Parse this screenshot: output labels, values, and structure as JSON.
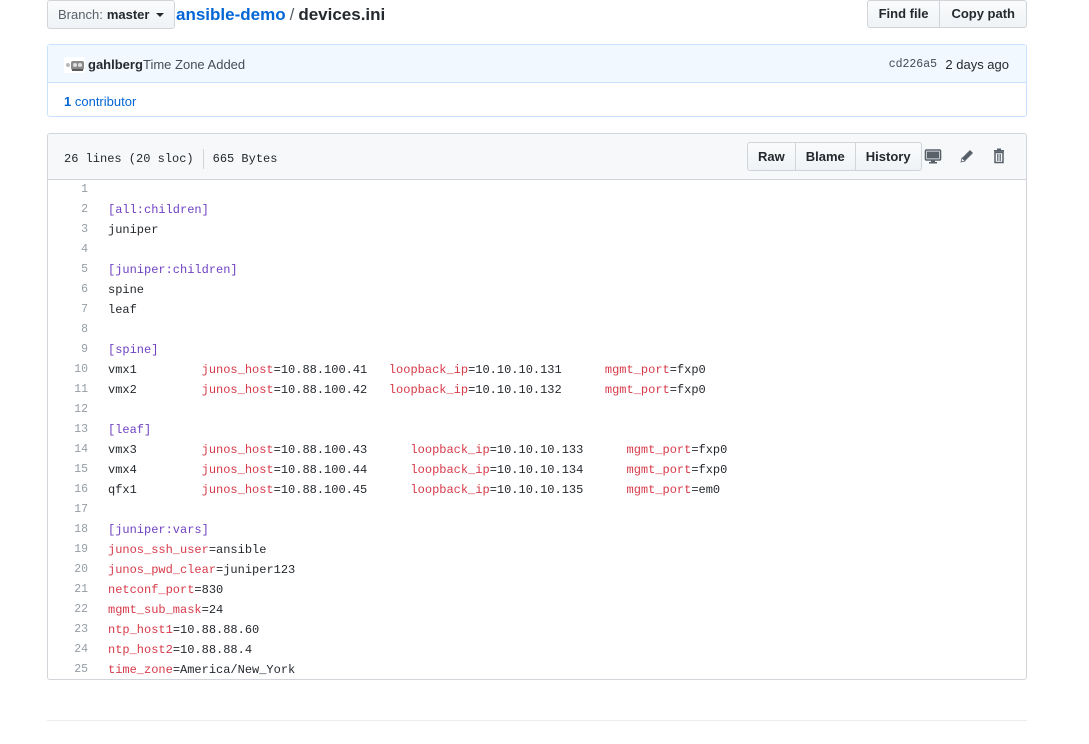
{
  "topbar": {
    "branch_label": "Branch:",
    "branch_value": "master",
    "repo": "ansible-demo",
    "separator": "/",
    "file": "devices.ini",
    "find_file": "Find file",
    "copy_path": "Copy path"
  },
  "commit": {
    "author": "gahlberg",
    "message": "Time Zone Added",
    "sha": "cd226a5",
    "when": "2 days ago",
    "contributor_count": "1",
    "contributor_label": "contributor"
  },
  "file_header": {
    "lines": "26 lines (20 sloc)",
    "size": "665 Bytes",
    "raw": "Raw",
    "blame": "Blame",
    "history": "History"
  },
  "code_lines": [
    {
      "n": "1",
      "parts": []
    },
    {
      "n": "2",
      "parts": [
        {
          "t": "[all:children]",
          "c": "sec"
        }
      ]
    },
    {
      "n": "3",
      "parts": [
        {
          "t": "juniper",
          "c": "val"
        }
      ]
    },
    {
      "n": "4",
      "parts": []
    },
    {
      "n": "5",
      "parts": [
        {
          "t": "[juniper:children]",
          "c": "sec"
        }
      ]
    },
    {
      "n": "6",
      "parts": [
        {
          "t": "spine",
          "c": "val"
        }
      ]
    },
    {
      "n": "7",
      "parts": [
        {
          "t": "leaf",
          "c": "val"
        }
      ]
    },
    {
      "n": "8",
      "parts": []
    },
    {
      "n": "9",
      "parts": [
        {
          "t": "[spine]",
          "c": "sec"
        }
      ]
    },
    {
      "n": "10",
      "parts": [
        {
          "t": "vmx1         ",
          "c": "val"
        },
        {
          "t": "junos_host",
          "c": "key"
        },
        {
          "t": "=10.88.100.41   ",
          "c": "val"
        },
        {
          "t": "loopback_ip",
          "c": "key"
        },
        {
          "t": "=10.10.10.131      ",
          "c": "val"
        },
        {
          "t": "mgmt_port",
          "c": "key"
        },
        {
          "t": "=fxp0",
          "c": "val"
        }
      ]
    },
    {
      "n": "11",
      "parts": [
        {
          "t": "vmx2         ",
          "c": "val"
        },
        {
          "t": "junos_host",
          "c": "key"
        },
        {
          "t": "=10.88.100.42   ",
          "c": "val"
        },
        {
          "t": "loopback_ip",
          "c": "key"
        },
        {
          "t": "=10.10.10.132      ",
          "c": "val"
        },
        {
          "t": "mgmt_port",
          "c": "key"
        },
        {
          "t": "=fxp0",
          "c": "val"
        }
      ]
    },
    {
      "n": "12",
      "parts": []
    },
    {
      "n": "13",
      "parts": [
        {
          "t": "[leaf]",
          "c": "sec"
        }
      ]
    },
    {
      "n": "14",
      "parts": [
        {
          "t": "vmx3         ",
          "c": "val"
        },
        {
          "t": "junos_host",
          "c": "key"
        },
        {
          "t": "=10.88.100.43      ",
          "c": "val"
        },
        {
          "t": "loopback_ip",
          "c": "key"
        },
        {
          "t": "=10.10.10.133      ",
          "c": "val"
        },
        {
          "t": "mgmt_port",
          "c": "key"
        },
        {
          "t": "=fxp0",
          "c": "val"
        }
      ]
    },
    {
      "n": "15",
      "parts": [
        {
          "t": "vmx4         ",
          "c": "val"
        },
        {
          "t": "junos_host",
          "c": "key"
        },
        {
          "t": "=10.88.100.44      ",
          "c": "val"
        },
        {
          "t": "loopback_ip",
          "c": "key"
        },
        {
          "t": "=10.10.10.134      ",
          "c": "val"
        },
        {
          "t": "mgmt_port",
          "c": "key"
        },
        {
          "t": "=fxp0",
          "c": "val"
        }
      ]
    },
    {
      "n": "16",
      "parts": [
        {
          "t": "qfx1         ",
          "c": "val"
        },
        {
          "t": "junos_host",
          "c": "key"
        },
        {
          "t": "=10.88.100.45      ",
          "c": "val"
        },
        {
          "t": "loopback_ip",
          "c": "key"
        },
        {
          "t": "=10.10.10.135      ",
          "c": "val"
        },
        {
          "t": "mgmt_port",
          "c": "key"
        },
        {
          "t": "=em0",
          "c": "val"
        }
      ]
    },
    {
      "n": "17",
      "parts": []
    },
    {
      "n": "18",
      "parts": [
        {
          "t": "[juniper:vars]",
          "c": "sec"
        }
      ]
    },
    {
      "n": "19",
      "parts": [
        {
          "t": "junos_ssh_user",
          "c": "key"
        },
        {
          "t": "=ansible",
          "c": "val"
        }
      ]
    },
    {
      "n": "20",
      "parts": [
        {
          "t": "junos_pwd_clear",
          "c": "key"
        },
        {
          "t": "=juniper123",
          "c": "val"
        }
      ]
    },
    {
      "n": "21",
      "parts": [
        {
          "t": "netconf_port",
          "c": "key"
        },
        {
          "t": "=830",
          "c": "val"
        }
      ]
    },
    {
      "n": "22",
      "parts": [
        {
          "t": "mgmt_sub_mask",
          "c": "key"
        },
        {
          "t": "=24",
          "c": "val"
        }
      ]
    },
    {
      "n": "23",
      "parts": [
        {
          "t": "ntp_host1",
          "c": "key"
        },
        {
          "t": "=10.88.88.60",
          "c": "val"
        }
      ]
    },
    {
      "n": "24",
      "parts": [
        {
          "t": "ntp_host2",
          "c": "key"
        },
        {
          "t": "=10.88.88.4",
          "c": "val"
        }
      ]
    },
    {
      "n": "25",
      "parts": [
        {
          "t": "time_zone",
          "c": "key"
        },
        {
          "t": "=America/New_York",
          "c": "val"
        }
      ]
    }
  ],
  "icons": {
    "desktop": "desktop-icon",
    "edit": "pencil-icon",
    "delete": "trashcan-icon"
  },
  "colors": {
    "link": "#0366d6",
    "section": "#6f42c1",
    "key": "#d73a49"
  }
}
